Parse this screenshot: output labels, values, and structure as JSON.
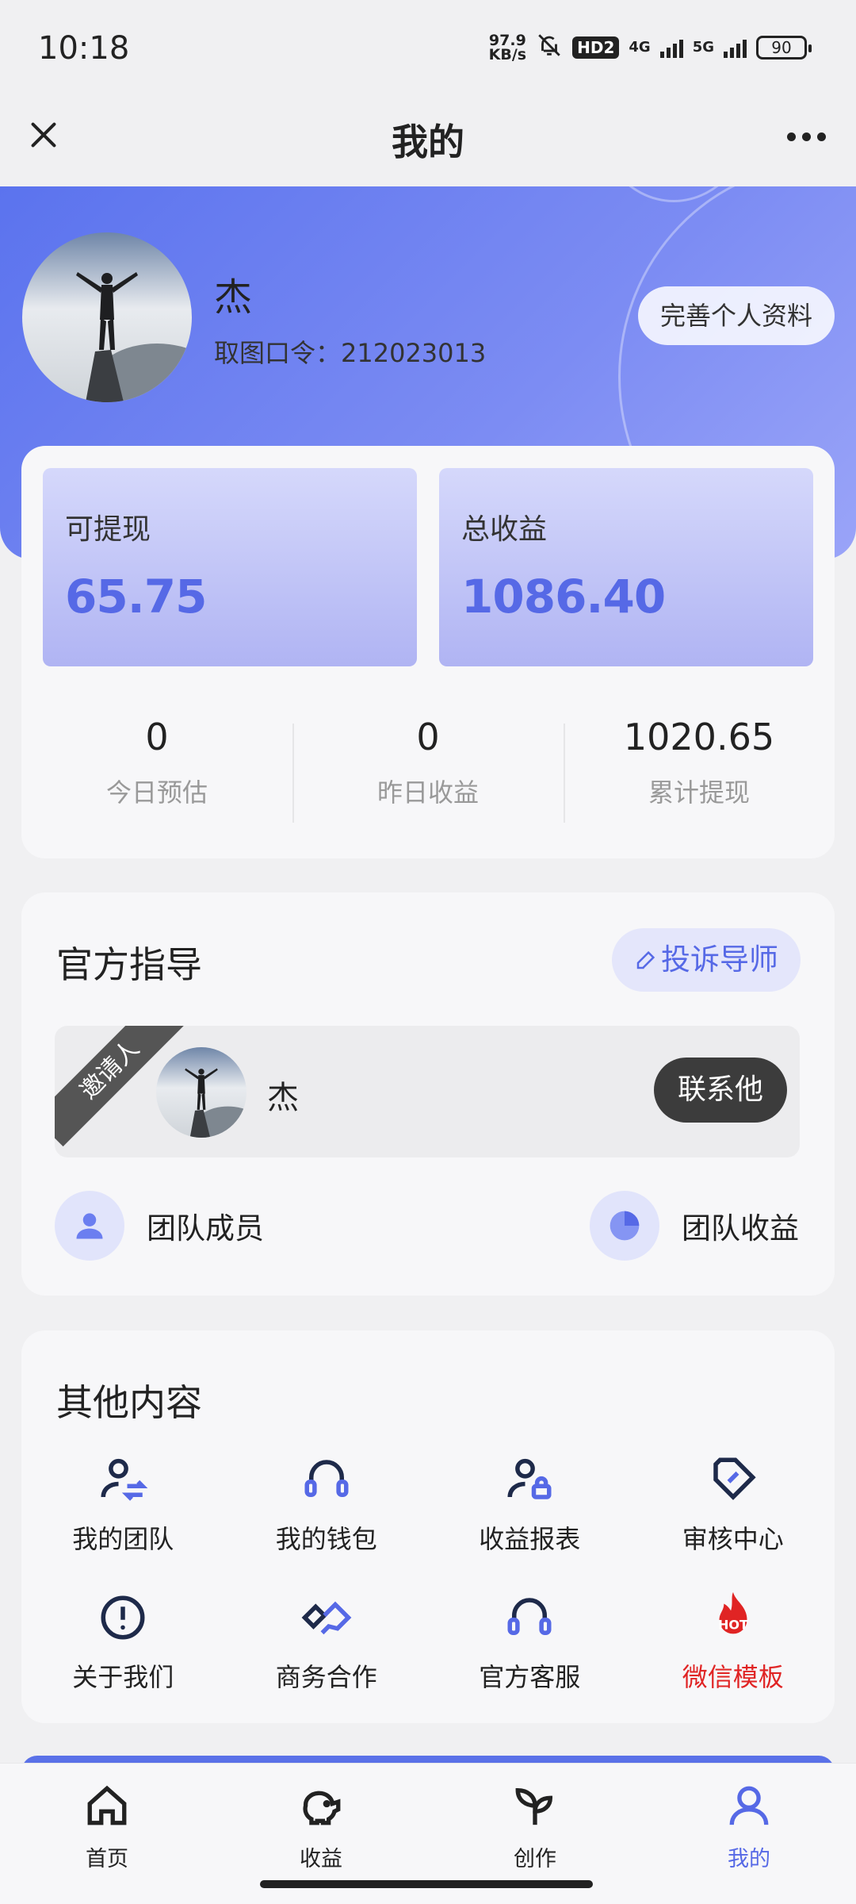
{
  "status_bar": {
    "time": "10:18",
    "net_speed_value": "97.9",
    "net_speed_unit": "KB/s",
    "hd_badge": "HD2",
    "net1": "4G",
    "net2": "5G",
    "battery": "90",
    "icons": [
      "bell-muted-icon",
      "signal-icon",
      "battery-icon"
    ]
  },
  "navbar": {
    "title": "我的",
    "left_icon": "close-icon",
    "right_icon": "more-icon"
  },
  "profile": {
    "name": "杰",
    "code_line": "取图口令：212023013",
    "complete_button": "完善个人资料"
  },
  "earnings": {
    "withdrawable_label": "可提现",
    "withdrawable_value": "65.75",
    "total_label": "总收益",
    "total_value": "1086.40",
    "stats": [
      {
        "value": "0",
        "label": "今日预估"
      },
      {
        "value": "0",
        "label": "昨日收益"
      },
      {
        "value": "1020.65",
        "label": "累计提现"
      }
    ]
  },
  "guide": {
    "title": "官方指导",
    "complain_button": "投诉导师",
    "inviter_ribbon": "邀请人",
    "inviter_name": "杰",
    "contact_button": "联系他",
    "team_members": "团队成员",
    "team_income": "团队收益"
  },
  "other": {
    "title": "其他内容",
    "items": [
      {
        "label": "我的团队",
        "icon": "team-swap-icon"
      },
      {
        "label": "我的钱包",
        "icon": "headset-icon"
      },
      {
        "label": "收益报表",
        "icon": "user-lock-icon"
      },
      {
        "label": "审核中心",
        "icon": "review-tag-icon"
      },
      {
        "label": "关于我们",
        "icon": "info-circle-icon"
      },
      {
        "label": "商务合作",
        "icon": "handshake-icon"
      },
      {
        "label": "官方客服",
        "icon": "headset-icon"
      },
      {
        "label": "微信模板",
        "icon": "hot-flame-icon",
        "badge": "HOT"
      }
    ]
  },
  "tabbar": {
    "tabs": [
      {
        "label": "首页",
        "icon": "home-icon"
      },
      {
        "label": "收益",
        "icon": "piggy-bank-icon"
      },
      {
        "label": "创作",
        "icon": "plant-icon"
      },
      {
        "label": "我的",
        "icon": "person-icon",
        "active": true
      }
    ]
  },
  "colors": {
    "accent": "#5669e6",
    "hero_start": "#5b73ee",
    "hot_red": "#e02424"
  }
}
